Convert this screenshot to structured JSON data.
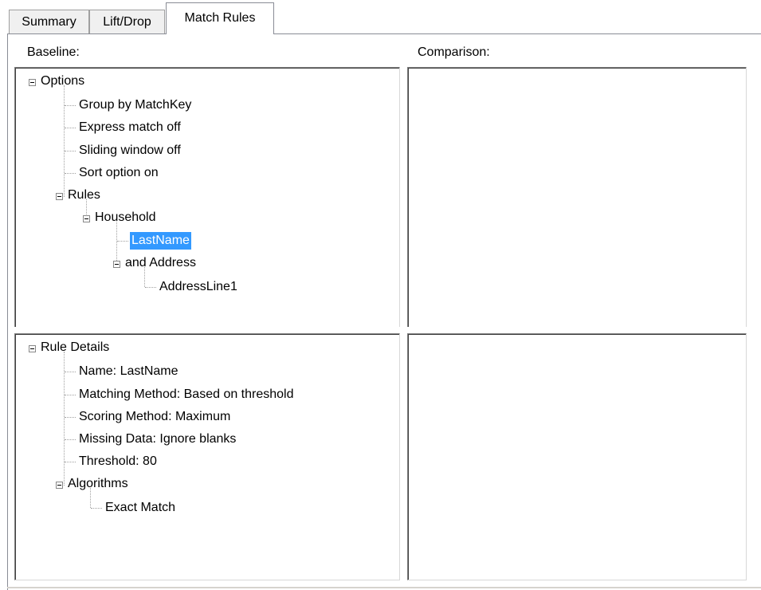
{
  "tabs": [
    {
      "label": "Summary"
    },
    {
      "label": "Lift/Drop"
    },
    {
      "label": "Match Rules"
    }
  ],
  "baseline_label": "Baseline:",
  "comparison_label": "Comparison:",
  "baseline_tree": {
    "root": "Options",
    "items": [
      "Group by MatchKey",
      "Express match off",
      "Sliding window off",
      "Sort option on"
    ],
    "rules": "Rules",
    "household": "Household",
    "lastname": "LastName",
    "and_address": "and Address",
    "addressline1": "AddressLine1"
  },
  "details_tree": {
    "root": "Rule Details",
    "items": [
      "Name: LastName",
      "Matching Method: Based on threshold",
      "Scoring Method: Maximum",
      "Missing Data: Ignore blanks",
      "Threshold: 80"
    ],
    "algorithms": "Algorithms",
    "exact_match": "Exact Match"
  }
}
